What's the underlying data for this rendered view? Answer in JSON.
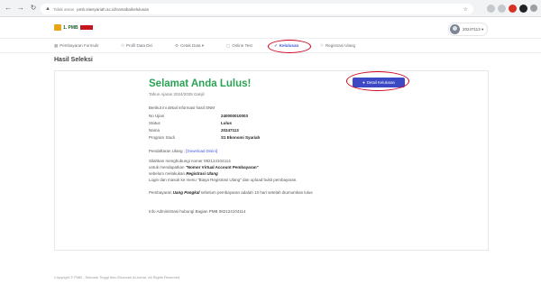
{
  "browser": {
    "secure_label": "Tidak aman",
    "url": "pmb.stiesyariah.ac.id/camaba/kelulusan"
  },
  "header": {
    "logo_text": "1. PMB",
    "user_name": "20247113 ▾"
  },
  "menu": {
    "items": [
      {
        "icon": "▦",
        "label": "Pembayaran Formulir"
      },
      {
        "icon": "⚇",
        "label": "Profil Data Diri"
      },
      {
        "icon": "⚙",
        "label": "Cetak Data ▾"
      },
      {
        "icon": "▢",
        "label": "Online Test"
      },
      {
        "icon": "✓",
        "label": "Kelulusan"
      },
      {
        "icon": "⚐",
        "label": "Registrasi Ulang"
      }
    ]
  },
  "page": {
    "section_title": "Hasil Seleksi",
    "headline": "Selamat Anda Lulus!",
    "subtitle": "Tahun Ajaran 2024/2025 Ganjil",
    "detail_button": "Detail Kelulusan",
    "detail_icon": "●",
    "intro": "Berikut ini detail informasi hasil SNM",
    "info_rows": [
      {
        "label": "No Ujian",
        "value": "240000010003"
      },
      {
        "label": "Status",
        "value": "Lulus"
      },
      {
        "label": "Nama",
        "value": "20247113"
      },
      {
        "label": "Program Studi",
        "value": "S1 Ekonomi Syariah"
      }
    ],
    "reg_prefix": "Pendaftaran Ulang : ",
    "reg_link": "[Download Disini]",
    "line1": "Silahkan menghubungi nomer 082124104114",
    "line2a": "untuk mendapatkan ",
    "line2b": "\"Nomor Virtual Account Pembayaran\"",
    "line3a": "sebelum melakukan ",
    "line3b": "Registrasi Ulang",
    "line4": "Login dan masuk ke menu \"Biaya Registrasi Ulang\" dan upload bukti pembayaran.",
    "line5a": "Pembayaran ",
    "line5b": "Uang Pangkal",
    "line5c": " sebelum pembayaran adalah 10 hari setelah diumumkan lulus",
    "line6": "Info Administrasi hubungi Bagian PMB 082124104114",
    "footer": "Copyright © PMB - Sekolah Tinggi Ilmu Ekonomi Al-Azhar. All Rights Reserved"
  }
}
